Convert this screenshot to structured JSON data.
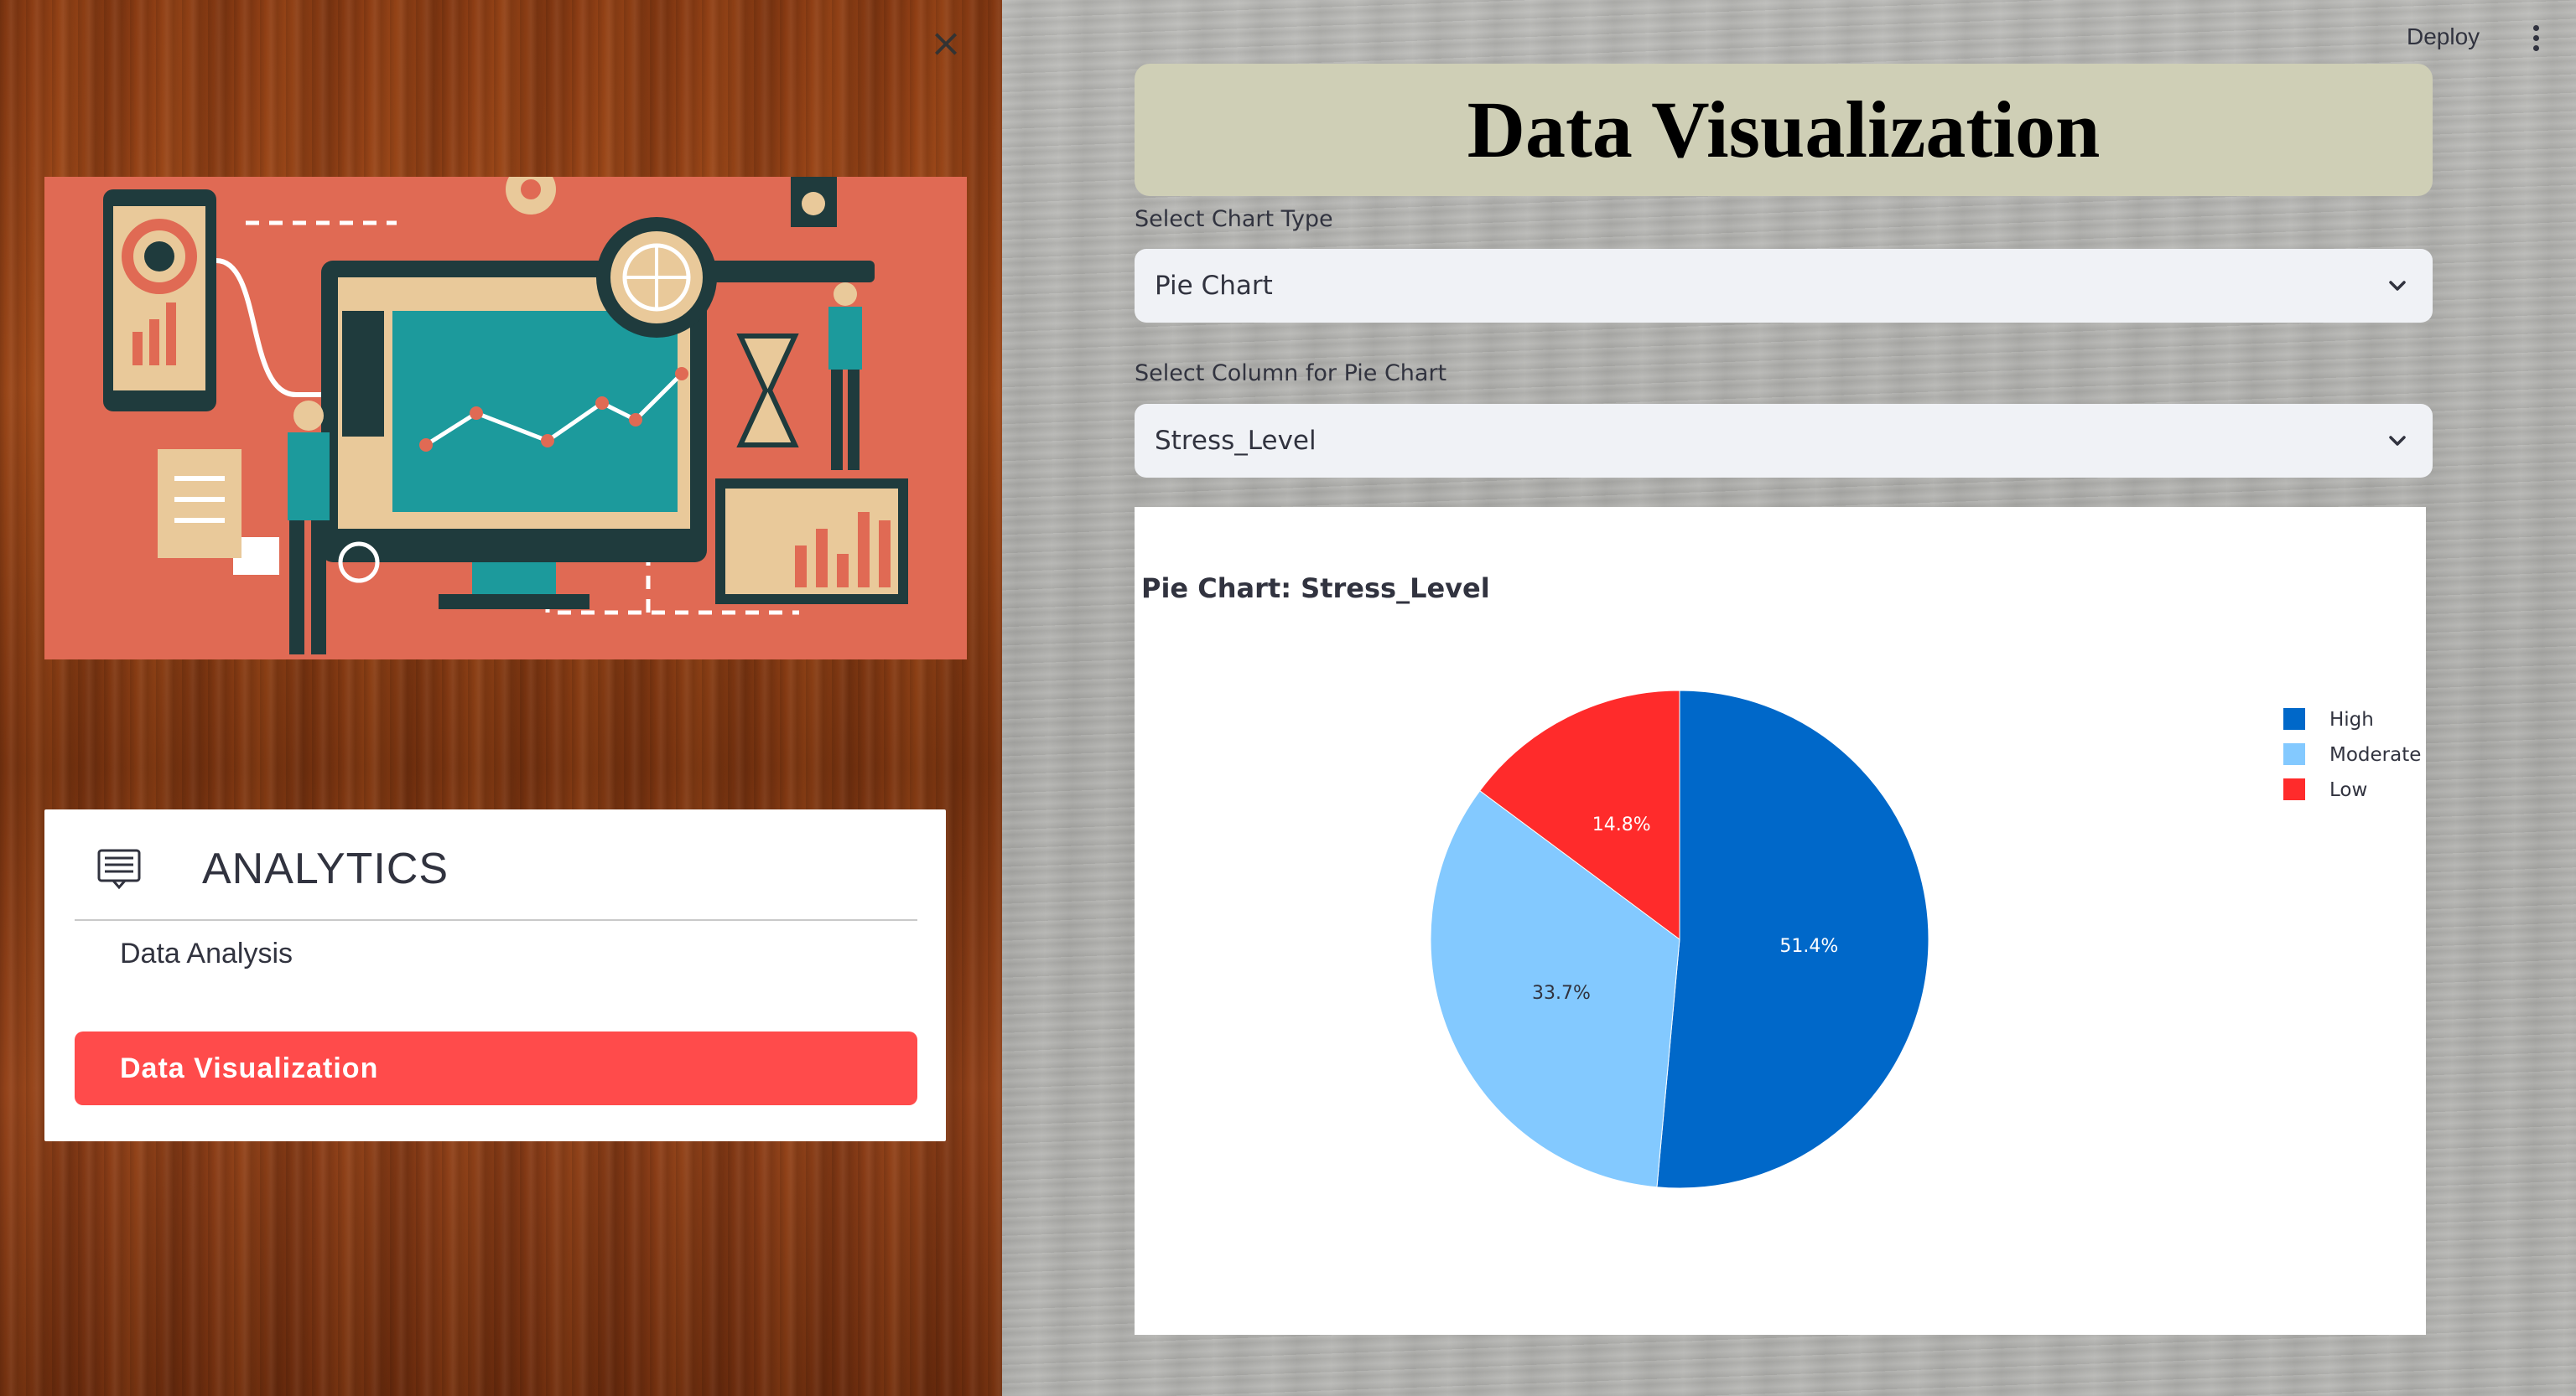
{
  "sidebar": {
    "close_icon": "close-icon",
    "menu": {
      "title": "ANALYTICS",
      "icon": "list-icon",
      "items": [
        {
          "label": "Data Analysis",
          "active": false
        },
        {
          "label": "Data Visualization",
          "active": true
        }
      ],
      "active_color": "#ff4b4b"
    }
  },
  "header": {
    "deploy_label": "Deploy",
    "menu_icon": "vertical-dots-icon"
  },
  "main": {
    "title": "Data Visualization",
    "chart_type_label": "Select Chart Type",
    "chart_type_value": "Pie Chart",
    "column_label": "Select Column for Pie Chart",
    "column_value": "Stress_Level"
  },
  "chart_data": {
    "type": "pie",
    "title": "Pie Chart: Stress_Level",
    "categories": [
      "High",
      "Moderate",
      "Low"
    ],
    "values": [
      51.4,
      33.7,
      14.8
    ],
    "labels": [
      "51.4%",
      "33.7%",
      "14.8%"
    ],
    "colors": [
      "#0068c9",
      "#83c9ff",
      "#ff2b2b"
    ],
    "legend_position": "top-right"
  }
}
